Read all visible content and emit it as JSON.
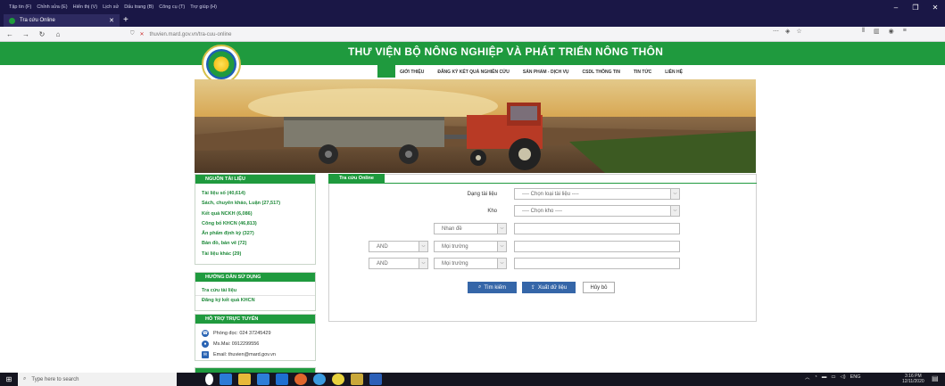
{
  "browser": {
    "menu": [
      "Tập tin (F)",
      "Chỉnh sửa (E)",
      "Hiển thị (V)",
      "Lịch sử",
      "Dấu trang (B)",
      "Công cụ (T)",
      "Trợ giúp (H)"
    ],
    "tab_title": "Tra cứu Online",
    "url": "thuvien.mard.gov.vn/tra-cuu-online",
    "icons": {
      "back": "back-arrow-icon",
      "forward": "forward-arrow-icon",
      "reload": "reload-icon",
      "home": "home-icon",
      "shield": "shield-icon",
      "lock": "lock-icon",
      "more": "more-dots-icon",
      "pocket": "pocket-icon",
      "star": "star-icon",
      "library": "library-icon",
      "sidebar": "sidebar-icon",
      "account": "account-icon",
      "menu": "hamburger-icon"
    }
  },
  "site": {
    "title": "THƯ VIỆN BỘ NÔNG NGHIỆP VÀ PHÁT TRIỂN NÔNG THÔN",
    "nav": [
      "GIỚI THIỆU",
      "ĐĂNG KÝ KẾT QUẢ NGHIÊN CỨU",
      "SẢN PHẨM - DỊCH VỤ",
      "CSDL THÔNG TIN",
      "TIN TỨC",
      "LIÊN HỆ"
    ],
    "accent": "#1f9a3e"
  },
  "sidebar": {
    "sources_title": "NGUỒN TÀI LIỆU",
    "sources": [
      "Tài liệu số (40,614)",
      "Sách, chuyên khảo, Luận (27,517)",
      "Kết quả NCKH (6,086)",
      "Công bố KHCN (46,813)",
      "Ấn phẩm định kỳ (327)",
      "Bản đồ, bản vẽ (72)",
      "Tài liệu khác (29)"
    ],
    "guide_title": "HƯỚNG DẪN SỬ DỤNG",
    "guide": [
      "Tra cứu tài liệu",
      "Đăng ký kết quả KHCN"
    ],
    "support_title": "HỖ TRỢ TRỰC TUYẾN",
    "support": [
      "Phòng đọc: 024 37245429",
      "Ms.Mai: 0912299556",
      "Email: thuvien@mard.gov.vn"
    ],
    "last_title": "... TIN"
  },
  "search": {
    "tab_label": "Tra cứu Online",
    "doc_type_label": "Dạng tài liệu",
    "doc_type_value": "---- Chọn loại tài liệu ----",
    "repo_label": "Kho",
    "repo_value": "---- Chọn kho ----",
    "field1": "Nhan đề",
    "op2": "AND",
    "field2": "Mọi trường",
    "op3": "AND",
    "field3": "Mọi trường",
    "search_btn": "Tìm kiếm",
    "export_btn": "Xuất dữ liệu",
    "cancel_btn": "Hủy bỏ"
  },
  "taskbar": {
    "search_placeholder": "Type here to search",
    "lang": "ENG",
    "time": "3:16 PM",
    "date": "12/11/2020"
  }
}
